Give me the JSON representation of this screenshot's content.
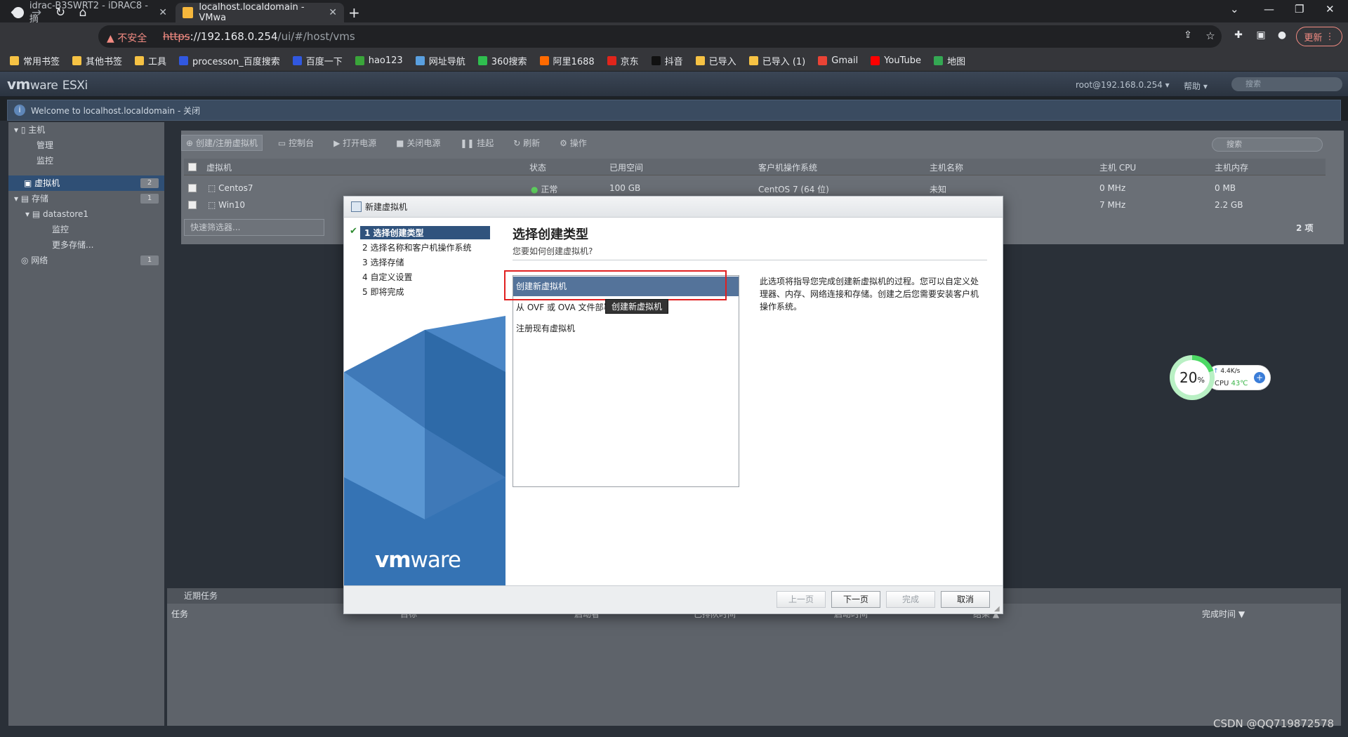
{
  "browser": {
    "tabs": [
      {
        "title": "idrac-B3SWRT2 - iDRAC8 - 摘"
      },
      {
        "title": "localhost.localdomain - VMwa"
      }
    ],
    "new_tab": "+",
    "security_label": "不安全",
    "url_protocol": "https",
    "url_host": "://192.168.0.254",
    "url_path": "/ui/#/host/vms",
    "update_label": "更新",
    "bookmarks": [
      {
        "label": "常用书签",
        "color": "#f6c244"
      },
      {
        "label": "其他书签",
        "color": "#f6c244"
      },
      {
        "label": "工具",
        "color": "#f6c244"
      },
      {
        "label": "processon_百度搜索",
        "color": "#3158e0"
      },
      {
        "label": "百度一下",
        "color": "#3158e0"
      },
      {
        "label": "hao123",
        "color": "#3aa53a"
      },
      {
        "label": "网址导航",
        "color": "#5aa0e0"
      },
      {
        "label": "360搜索",
        "color": "#2fbe4f"
      },
      {
        "label": "阿里1688",
        "color": "#ff6a00"
      },
      {
        "label": "京东",
        "color": "#e1251b"
      },
      {
        "label": "抖音",
        "color": "#111111"
      },
      {
        "label": "已导入",
        "color": "#f6c244"
      },
      {
        "label": "已导入 (1)",
        "color": "#f6c244"
      },
      {
        "label": "Gmail",
        "color": "#ea4335"
      },
      {
        "label": "YouTube",
        "color": "#ff0000"
      },
      {
        "label": "地图",
        "color": "#34a853"
      }
    ]
  },
  "esxi": {
    "logo": "vm",
    "logo_rest": "ware",
    "logo_product": "ESXi",
    "user": "root@192.168.0.254 ▾",
    "help": "帮助 ▾",
    "search_placeholder": "搜索",
    "welcome": "Welcome to localhost.localdomain - 关闭",
    "navigator": {
      "host": "主机",
      "manage": "管理",
      "monitor": "监控",
      "vms": "虚拟机",
      "vms_count": "2",
      "storage": "存储",
      "storage_count": "1",
      "datastore": "datastore1",
      "ds_monitor": "监控",
      "more_storage": "更多存储...",
      "network": "网络",
      "network_count": "1"
    },
    "toolbar": {
      "create": "创建/注册虚拟机",
      "console": "控制台",
      "power_on": "打开电源",
      "power_off": "关闭电源",
      "suspend": "挂起",
      "refresh": "刷新",
      "actions": "操作",
      "search_placeholder": "搜索"
    },
    "grid": {
      "columns": [
        "虚拟机",
        "状态",
        "已用空间",
        "客户机操作系统",
        "主机名称",
        "主机 CPU",
        "主机内存"
      ],
      "rows": [
        {
          "name": "Centos7",
          "status": "正常",
          "used": "100 GB",
          "os": "CentOS 7 (64 位)",
          "host": "未知",
          "cpu": "0 MHz",
          "mem": "0 MB"
        },
        {
          "name": "Win10",
          "status": "",
          "used": "",
          "os": "",
          "host": "",
          "cpu": "7 MHz",
          "mem": "2.2 GB"
        }
      ],
      "quick_filter": "快速筛选器...",
      "count": "2 项"
    },
    "tasks": {
      "title": "近期任务",
      "columns": [
        "任务",
        "目标",
        "启动者",
        "已排队时间",
        "启动时间",
        "结果 ▲",
        "完成时间 ▼"
      ]
    }
  },
  "wizard": {
    "title": "新建虚拟机",
    "steps": [
      "1 选择创建类型",
      "2 选择名称和客户机操作系统",
      "3 选择存储",
      "4 自定义设置",
      "5 即将完成"
    ],
    "heading": "选择创建类型",
    "subheading": "您要如何创建虚拟机?",
    "options": [
      "创建新虚拟机",
      "从 OVF 或 OVA 文件部署",
      "注册现有虚拟机"
    ],
    "tooltip": "创建新虚拟机",
    "description": "此选项将指导您完成创建新虚拟机的过程。您可以自定义处理器、内存、网络连接和存储。创建之后您需要安装客户机操作系统。",
    "brand_vm": "vm",
    "brand_ware": "ware",
    "buttons": {
      "back": "上一页",
      "next": "下一页",
      "finish": "完成",
      "cancel": "取消"
    }
  },
  "cpu_widget": {
    "percent": "20",
    "percent_sign": "%",
    "percent_value": 0.2,
    "speed": "4.4K/s",
    "cpu_label": "CPU",
    "temp": "43℃",
    "plus": "+"
  },
  "watermark": "CSDN @QQ719872578",
  "colors": {
    "accent": "#30537d",
    "selected_option": "#54739a",
    "highlight_box": "#e02020",
    "ok_green": "#2e8b30"
  }
}
